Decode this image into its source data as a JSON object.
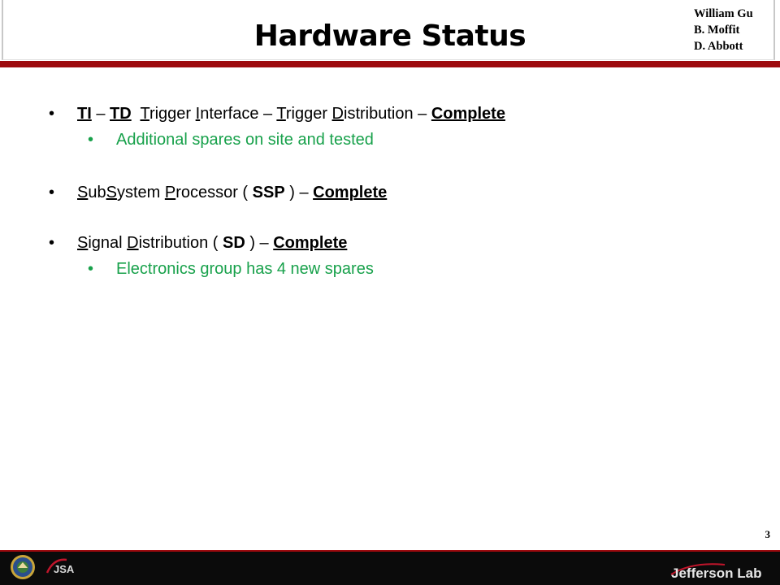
{
  "header": {
    "title": "Hardware Status",
    "authors": [
      "William Gu",
      "B. Moffit",
      "D. Abbott"
    ]
  },
  "bullets": {
    "tiTd": {
      "ti": "TI",
      "dash1": " – ",
      "td": "TD",
      "gap": "  ",
      "t1": "T",
      "t1rest": "rigger ",
      "i1": "I",
      "i1rest": "nterface – ",
      "t2": "T",
      "t2rest": "rigger ",
      "d1": "D",
      "d1rest": "istribution – ",
      "status": "Complete",
      "sub": "Additional spares on site and tested"
    },
    "ssp": {
      "s1": "S",
      "s1rest": "ub",
      "s2": "S",
      "s2rest": "ystem ",
      "p1": "P",
      "p1rest": "rocessor ( ",
      "abbr": "SSP",
      "close": " ) – ",
      "status": "Complete"
    },
    "sd": {
      "s1": "S",
      "s1rest": "ignal ",
      "d1": "D",
      "d1rest": "istribution ( ",
      "abbr": "SD",
      "close": " ) – ",
      "status": "Complete",
      "sub": "Electronics group has 4 new spares"
    }
  },
  "bullet_glyph": "•",
  "footer": {
    "page_number": "3",
    "logo_jsa_text": "JSA",
    "logo_jlab_text": "Jefferson Lab"
  },
  "colors": {
    "brand_red": "#9d0a0e",
    "subbullet_green": "#18a14b",
    "footer_black": "#0b0b0b"
  }
}
